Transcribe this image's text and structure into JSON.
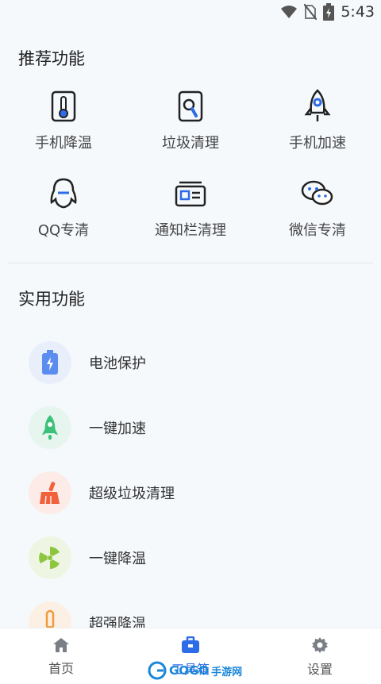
{
  "status_bar": {
    "time": "5:43"
  },
  "recommended": {
    "title": "推荐功能",
    "items": [
      {
        "label": "手机降温",
        "icon": "thermometer-icon"
      },
      {
        "label": "垃圾清理",
        "icon": "trash-search-icon"
      },
      {
        "label": "手机加速",
        "icon": "rocket-icon"
      },
      {
        "label": "QQ专清",
        "icon": "qq-penguin-icon"
      },
      {
        "label": "通知栏清理",
        "icon": "notification-card-icon"
      },
      {
        "label": "微信专清",
        "icon": "wechat-icon"
      }
    ]
  },
  "utilities": {
    "title": "实用功能",
    "items": [
      {
        "label": "电池保护",
        "icon": "battery-icon",
        "color": "#5b8df0",
        "bg": "#e9eefb"
      },
      {
        "label": "一键加速",
        "icon": "rocket-icon",
        "color": "#3cc07a",
        "bg": "#e6f6ee"
      },
      {
        "label": "超级垃圾清理",
        "icon": "broom-icon",
        "color": "#f0613c",
        "bg": "#fcebe6"
      },
      {
        "label": "一键降温",
        "icon": "fan-icon",
        "color": "#8cc63f",
        "bg": "#eef6e3"
      },
      {
        "label": "超强降温",
        "icon": "thermometer-icon",
        "color": "#f09a3c",
        "bg": "#fcefe3"
      }
    ]
  },
  "bottom_nav": {
    "items": [
      {
        "label": "首页",
        "icon": "home-icon"
      },
      {
        "label": "工具箱",
        "icon": "toolbox-icon"
      },
      {
        "label": "设置",
        "icon": "gear-icon"
      }
    ],
    "active_index": 1,
    "active_color": "#2e6be6"
  },
  "watermark": {
    "text": "GOGO",
    "text2": "手游网"
  }
}
